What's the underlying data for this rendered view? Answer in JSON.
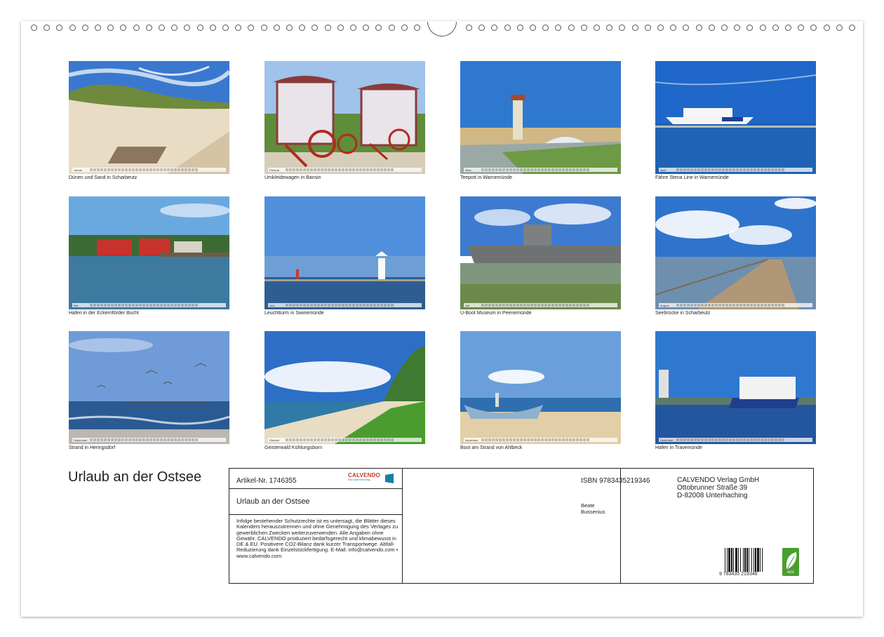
{
  "calendar_title": "Urlaub an der Ostsee",
  "photos": [
    {
      "caption": "Dünen und Sand in Scharbeutz",
      "month": "Januar"
    },
    {
      "caption": "Umkleidewagen in Bansin",
      "month": "Februar"
    },
    {
      "caption": "Teepott in Warnemünde",
      "month": "März"
    },
    {
      "caption": "Fähre Stena Line in Warnemünde",
      "month": "April"
    },
    {
      "caption": "Hafen in der Eckernförder Bucht",
      "month": "Mai"
    },
    {
      "caption": "Leuchtturm in Swinemünde",
      "month": "Juni"
    },
    {
      "caption": "U-Boot Museum in Peenemünde",
      "month": "Juli"
    },
    {
      "caption": "Seebrücke in Scharbeutz",
      "month": "August"
    },
    {
      "caption": "Strand in Heringsdorf",
      "month": "September"
    },
    {
      "caption": "Geisterwald Kühlungsborn",
      "month": "Oktober"
    },
    {
      "caption": "Boot am Strand von Ahlbeck",
      "month": "November"
    },
    {
      "caption": "Hafen in Travemünde",
      "month": "Dezember"
    }
  ],
  "info": {
    "article": "Artikel-Nr. 1746355",
    "title": "Urlaub an der Ostsee",
    "brand": "CALVENDO",
    "brand_tag": "Kein Kalenderverlag",
    "legal": "Infolge bestehender Schutzrechte ist es untersagt, die Blätter dieses Kalenders herauszutrennen und ohne Genehmigung des Verlages zu gewerblichen Zwecken weiterzuverwenden. Alle Angaben ohne Gewähr. CALVENDO produziert bedarfsgerecht und klimabewusst in DE & EU. Positivere CO2-Bilanz dank kurzer Transportwege. Abfall-Reduzierung dank Einzelstückfertigung. E-Mail: info@calvendo.com • www.calvendo.com",
    "isbn": "ISBN 9783435219346",
    "author": "Beate Bussenius",
    "publisher_name": "CALVENDO Verlag GmbH",
    "publisher_street": "Ottobrunner Straße 39",
    "publisher_city": "D-82008 Unterhaching",
    "barcode_digits": "9 783435 219346",
    "eco_label": "eco"
  }
}
